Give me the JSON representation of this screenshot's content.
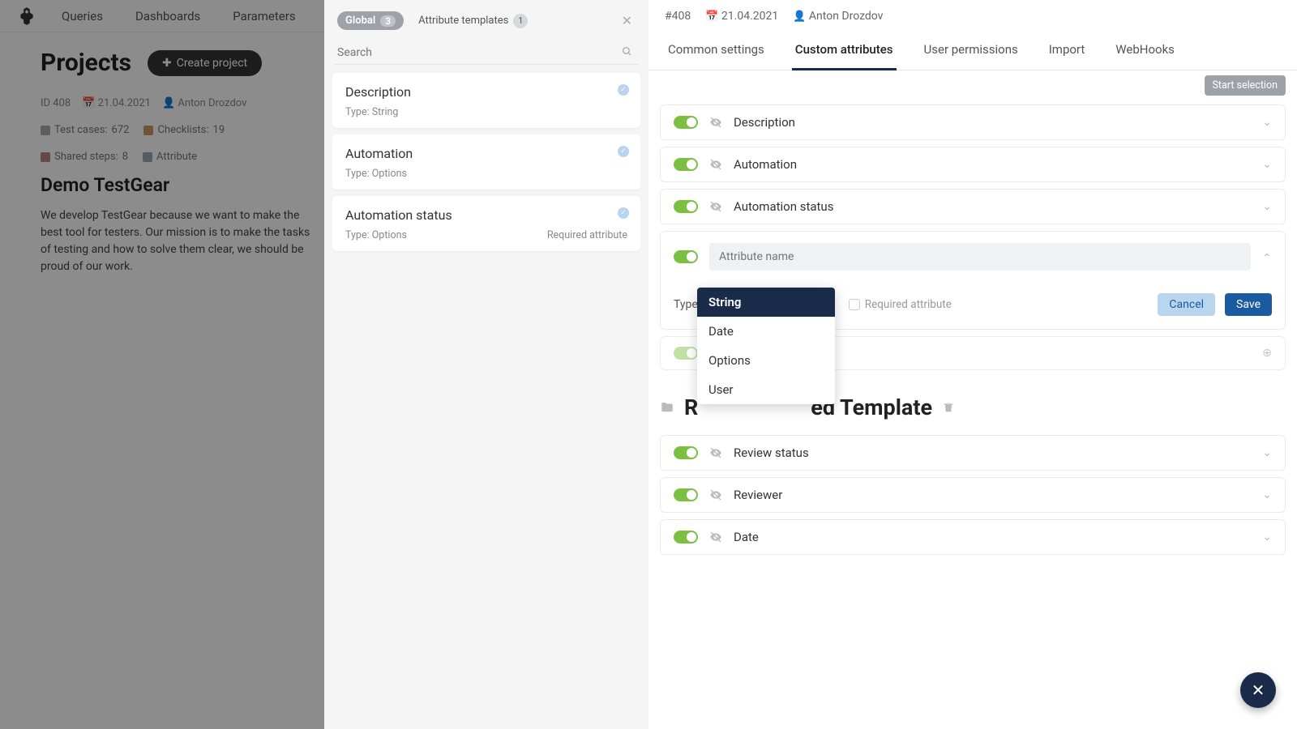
{
  "nav": {
    "items": [
      "Queries",
      "Dashboards",
      "Parameters"
    ]
  },
  "projects": {
    "title": "Projects",
    "create": "Create project",
    "meta": {
      "id": "ID 408",
      "date": "21.04.2021",
      "author": "Anton Drozdov"
    },
    "stats": {
      "testcases_label": "Test cases:",
      "testcases_value": "672",
      "checklists_label": "Checklists:",
      "checklists_value": "19",
      "shared_label": "Shared steps:",
      "shared_value": "8",
      "attr_label": "Attribute"
    },
    "name": "Demo TestGear",
    "desc": "We develop TestGear because we want to make the best tool for testers. Our mission is to make the tasks of testing and how to solve them clear, we should be proud of our work."
  },
  "side": {
    "global_label": "Global",
    "global_count": "3",
    "templates_label": "Attribute templates",
    "templates_count": "1",
    "search_placeholder": "Search",
    "items": [
      {
        "title": "Description",
        "type": "Type: String",
        "required": ""
      },
      {
        "title": "Automation",
        "type": "Type: Options",
        "required": ""
      },
      {
        "title": "Automation status",
        "type": "Type: Options",
        "required": "Required attribute"
      }
    ]
  },
  "main": {
    "head": {
      "id": "#408",
      "date": "21.04.2021",
      "author": "Anton Drozdov"
    },
    "tabs": [
      "Common settings",
      "Custom attributes",
      "User permissions",
      "Import",
      "WebHooks"
    ],
    "active_tab": 1,
    "start_selection": "Start selection",
    "rows_top": [
      "Description",
      "Automation",
      "Automation status"
    ],
    "edit": {
      "placeholder": "Attribute name",
      "type_label": "Type",
      "type_value": "String",
      "required_label": "Required attribute",
      "cancel": "Cancel",
      "save": "Save"
    },
    "dropdown": [
      "String",
      "Date",
      "Options",
      "User"
    ],
    "template_title_visible": "ed Template",
    "template_title_prefix": "R",
    "rows_tpl": [
      "Review status",
      "Reviewer",
      "Date"
    ]
  }
}
